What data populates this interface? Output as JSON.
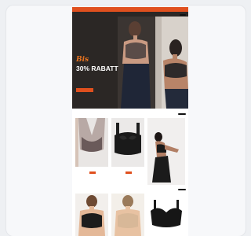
{
  "promo_bar": {
    "text": ""
  },
  "navbar": {
    "logo": "",
    "items": [
      "",
      "",
      "",
      ""
    ],
    "pill": ""
  },
  "hero": {
    "kicker": "Bis",
    "headline": "30% RABATT",
    "subtext": "",
    "cta": ""
  },
  "section1": {
    "title": "",
    "tabs": "",
    "button": ""
  },
  "section2": {
    "title": "",
    "button": ""
  },
  "products": [
    {
      "name": "",
      "price": "",
      "badge": ""
    },
    {
      "name": "",
      "price": "",
      "badge": ""
    },
    {
      "name": "",
      "price": "",
      "badge": ""
    },
    {
      "name": "",
      "price": "",
      "badge": ""
    },
    {
      "name": "",
      "price": "",
      "badge": ""
    }
  ],
  "colors": {
    "accent": "#e0501e",
    "hero_bg": "#2b2725",
    "kicker": "#e8731f"
  }
}
